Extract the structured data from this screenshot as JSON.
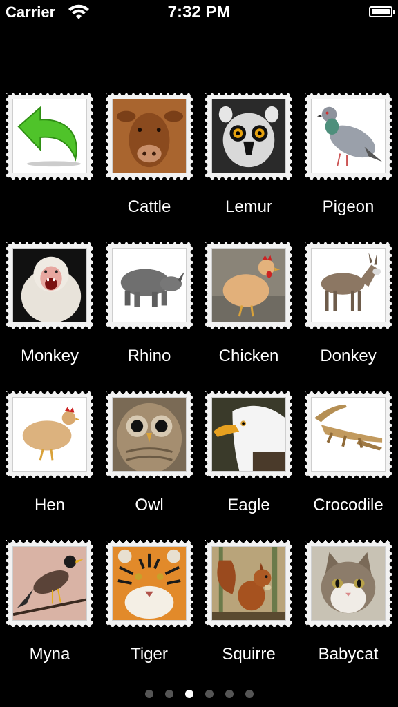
{
  "status": {
    "carrier": "Carrier",
    "time": "7:32 PM"
  },
  "grid": {
    "items": [
      {
        "label": "",
        "icon": "back-arrow-icon"
      },
      {
        "label": "Cattle"
      },
      {
        "label": "Lemur"
      },
      {
        "label": "Pigeon"
      },
      {
        "label": "Monkey"
      },
      {
        "label": "Rhino"
      },
      {
        "label": "Chicken"
      },
      {
        "label": "Donkey"
      },
      {
        "label": "Hen"
      },
      {
        "label": "Owl"
      },
      {
        "label": "Eagle"
      },
      {
        "label": "Crocodile"
      },
      {
        "label": "Myna"
      },
      {
        "label": "Tiger"
      },
      {
        "label": "Squirre"
      },
      {
        "label": "Babycat"
      }
    ]
  },
  "pager": {
    "count": 6,
    "active_index": 2
  }
}
